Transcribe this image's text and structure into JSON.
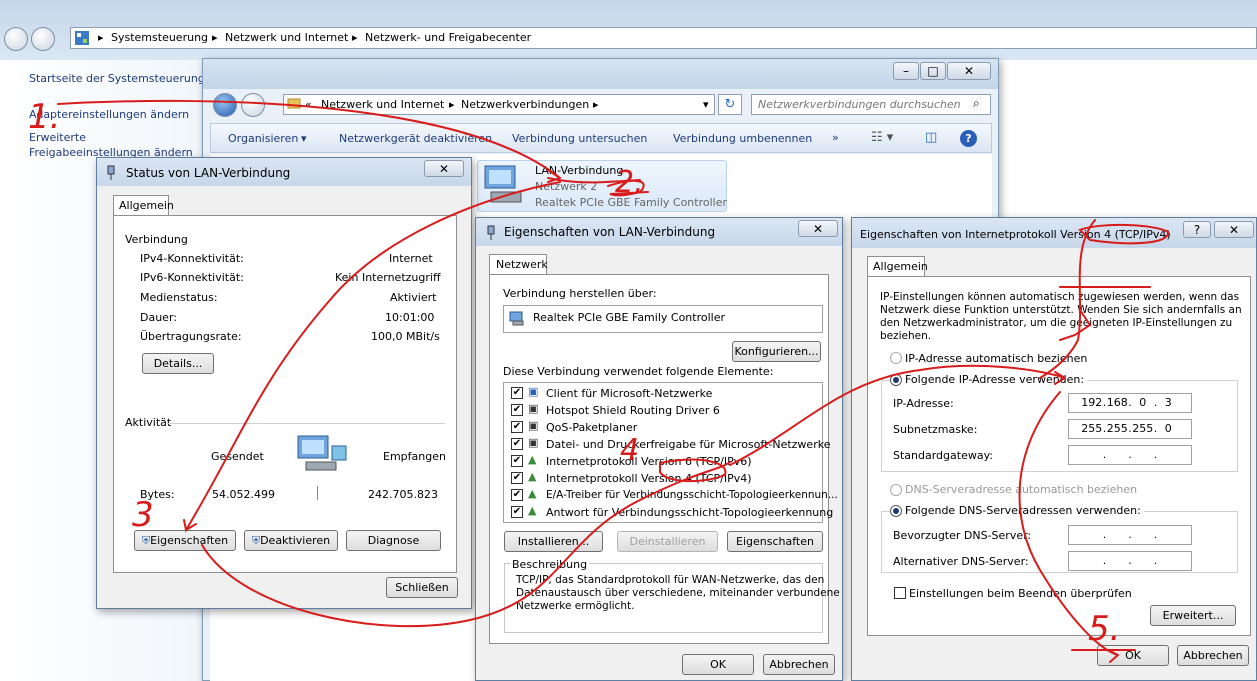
{
  "explorer": {
    "breadcrumb": [
      "Systemsteuerung",
      "Netzwerk und Internet",
      "Netzwerk- und Freigabecenter"
    ],
    "sidebar": [
      "Startseite der Systemsteuerung",
      "Adaptereinstellungen ändern",
      "Erweiterte",
      "Freigabeeinstellungen ändern"
    ]
  },
  "netconn": {
    "breadcrumb": [
      "«",
      "Netzwerk und Internet",
      "Netzwerkverbindungen"
    ],
    "search_placeholder": "Netzwerkverbindungen durchsuchen",
    "toolbar": [
      "Organisieren",
      "Netzwerkgerät deaktivieren",
      "Verbindung untersuchen",
      "Verbindung umbenennen",
      "»"
    ],
    "adapter": {
      "name": "LAN-Verbindung",
      "network": "Netzwerk  2",
      "device": "Realtek PCIe GBE Family Controller"
    }
  },
  "status": {
    "title": "Status von LAN-Verbindung",
    "tab": "Allgemein",
    "section_connection": "Verbindung",
    "rows": [
      {
        "label": "IPv4-Konnektivität:",
        "value": "Internet"
      },
      {
        "label": "IPv6-Konnektivität:",
        "value": "Kein Internetzugriff"
      },
      {
        "label": "Medienstatus:",
        "value": "Aktiviert"
      },
      {
        "label": "Dauer:",
        "value": "10:01:00"
      },
      {
        "label": "Übertragungsrate:",
        "value": "100,0 MBit/s"
      }
    ],
    "details_btn": "Details...",
    "section_activity": "Aktivität",
    "sent": "Gesendet",
    "received": "Empfangen",
    "bytes_label": "Bytes:",
    "bytes_sent": "54.052.499",
    "bytes_received": "242.705.823",
    "btn_props": "Eigenschaften",
    "btn_disable": "Deaktivieren",
    "btn_diag": "Diagnose",
    "btn_close": "Schließen"
  },
  "props": {
    "title": "Eigenschaften von LAN-Verbindung",
    "tab": "Netzwerk",
    "connect_using": "Verbindung herstellen über:",
    "adapter": "Realtek PCIe GBE Family Controller",
    "configure_btn": "Konfigurieren...",
    "items_label": "Diese Verbindung verwendet folgende Elemente:",
    "items": [
      "Client für Microsoft-Netzwerke",
      "Hotspot Shield Routing Driver 6",
      "QoS-Paketplaner",
      "Datei- und Druckerfreigabe für Microsoft-Netzwerke",
      "Internetprotokoll Version 6 (TCP/IPv6)",
      "Internetprotokoll Version 4 (TCP/IPv4)",
      "E/A-Treiber für Verbindungsschicht-Topologieerkennun...",
      "Antwort für Verbindungsschicht-Topologieerkennung"
    ],
    "btn_install": "Installieren...",
    "btn_uninstall": "Deinstallieren",
    "btn_props": "Eigenschaften",
    "desc_label": "Beschreibung",
    "desc_lines": [
      "TCP/IP, das Standardprotokoll für WAN-Netzwerke, das den",
      "Datenaustausch über verschiedene, miteinander verbundene",
      "Netzwerke ermöglicht."
    ],
    "btn_ok": "OK",
    "btn_cancel": "Abbrechen"
  },
  "ipv4": {
    "title": "Eigenschaften von Internetprotokoll Version 4 (TCP/IPv4)",
    "tab": "Allgemein",
    "intro_lines": [
      "IP-Einstellungen können automatisch zugewiesen werden, wenn das",
      "Netzwerk diese Funktion unterstützt. Wenden Sie sich andernfalls an",
      "den Netzwerkadministrator, um die geeigneten IP-Einstellungen zu",
      "beziehen."
    ],
    "radio_auto_ip": "IP-Adresse automatisch beziehen",
    "radio_manual_ip": "Folgende IP-Adresse verwenden:",
    "ip_label": "IP-Adresse:",
    "ip": [
      "192",
      "168",
      "0",
      "3"
    ],
    "mask_label": "Subnetzmaske:",
    "mask": [
      "255",
      "255",
      "255",
      "0"
    ],
    "gw_label": "Standardgateway:",
    "radio_auto_dns": "DNS-Serveradresse automatisch beziehen",
    "radio_manual_dns": "Folgende DNS-Serveradressen verwenden:",
    "dns1_label": "Bevorzugter DNS-Server:",
    "dns2_label": "Alternativer DNS-Server:",
    "validate_label": "Einstellungen beim Beenden überprüfen",
    "btn_advanced": "Erweitert...",
    "btn_ok": "OK",
    "btn_cancel": "Abbrechen",
    "help": "?"
  },
  "annotations": [
    "1.",
    "2.",
    "3",
    "4",
    "5."
  ],
  "colors": {
    "annotation": "#d81c1c",
    "titlebar": "#c6d7ea",
    "dialog_bg": "#f0f0f0"
  }
}
